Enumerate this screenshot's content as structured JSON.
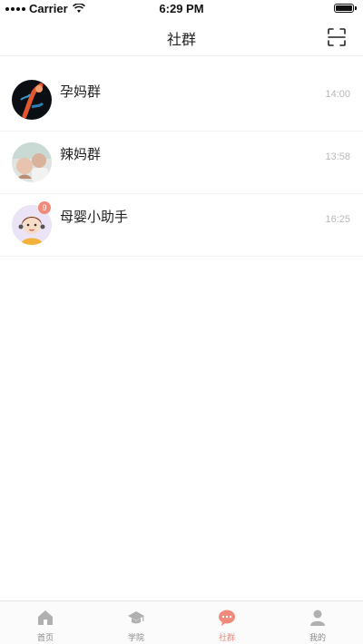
{
  "status_bar": {
    "carrier": "Carrier",
    "time": "6:29 PM"
  },
  "header": {
    "title": "社群",
    "scan_icon": "scan-icon"
  },
  "chats": [
    {
      "name": "孕妈群",
      "time": "14:00",
      "avatar": "group-photo-dark",
      "badge": ""
    },
    {
      "name": "辣妈群",
      "time": "13:58",
      "avatar": "group-photo-family",
      "badge": ""
    },
    {
      "name": "母婴小助手",
      "time": "16:25",
      "avatar": "assistant-cartoon-girl",
      "badge": "9"
    }
  ],
  "tabs": [
    {
      "label": "首页",
      "icon": "home-icon",
      "active": false
    },
    {
      "label": "学院",
      "icon": "graduation-cap-icon",
      "active": false
    },
    {
      "label": "社群",
      "icon": "chat-bubble-icon",
      "active": true
    },
    {
      "label": "我的",
      "icon": "person-icon",
      "active": false
    }
  ],
  "colors": {
    "accent": "#f08a7a",
    "inactive_tab": "#b0b0b0",
    "time_text": "#b8b8b8"
  }
}
